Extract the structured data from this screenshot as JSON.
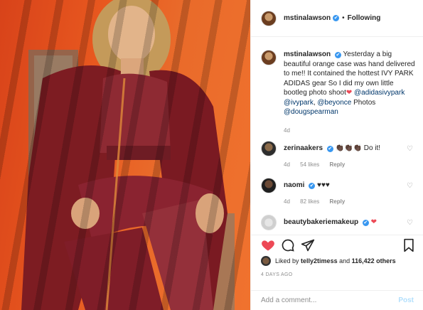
{
  "header": {
    "username": "mstinalawson",
    "verified_icon": "✔",
    "separator": "•",
    "follow_state": "Following"
  },
  "caption": {
    "username": "mstinalawson",
    "text_1": "Yesterday a big beautiful orange case was hand delivered to me!! It contained the hottest IVY PARK ADIDAS gear So I did my own little bootleg photo shoot",
    "heart": "❤",
    "mention_1": "@adidasivypark",
    "mention_2": "@ivypark",
    "mention_3": "@beyonce",
    "photos_label": "Photos",
    "mention_4": "@dougspearman",
    "comma": ",",
    "period": ".",
    "time": "4d"
  },
  "comments": [
    {
      "username": "zerinaakers",
      "text": "👏🏿👏🏿👏🏿 Do it!",
      "time": "4d",
      "likes": "54 likes",
      "reply": "Reply"
    },
    {
      "username": "naomi",
      "text": "♥♥♥",
      "time": "4d",
      "likes": "82 likes",
      "reply": "Reply"
    },
    {
      "username": "beautybakeriemakeup",
      "text": "❤",
      "time": "",
      "likes": "",
      "reply": ""
    }
  ],
  "likes": {
    "liked_by_label": "Liked by",
    "liked_by_user": "telly2timess",
    "and_label": "and",
    "others_count": "116,422 others"
  },
  "timestamp": "4 DAYS AGO",
  "comment_box": {
    "placeholder": "Add a comment...",
    "post_label": "Post"
  },
  "colors": {
    "accent_blue": "#3897f0",
    "like_red": "#ed4956",
    "post_disabled": "#b2dffc"
  }
}
